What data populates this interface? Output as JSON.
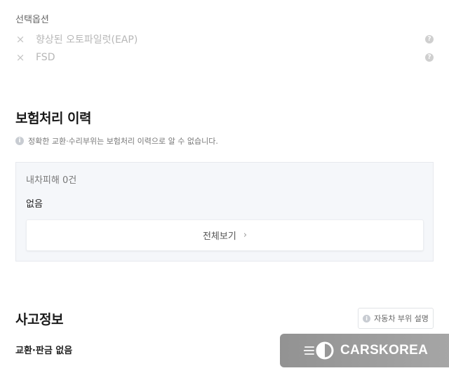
{
  "options": {
    "label": "선택옵션",
    "items": [
      {
        "name": "향상된 오토파일럿(EAP)"
      },
      {
        "name": "FSD"
      }
    ],
    "help_glyph": "?"
  },
  "insurance": {
    "title": "보험처리 이력",
    "info_glyph": "i",
    "notice": "정확한 교환·수리부위는 보험처리 이력으로 알 수 없습니다.",
    "damage_count": "내차피해 0건",
    "empty": "없음",
    "view_all_label": "전체보기",
    "chevron": "›"
  },
  "accident": {
    "title": "사고정보",
    "part_button_label": "자동차 부위 설명",
    "exchange_status": "교환·판금 없음"
  },
  "watermark": {
    "brand": "CARSKOREA"
  },
  "colors": {
    "muted_text": "#b7b7b7",
    "box_background": "#f5f7fa"
  },
  "icons": [
    "close-icon",
    "help-icon",
    "info-icon",
    "chevron-right-icon",
    "carskorea-logo-icon"
  ]
}
